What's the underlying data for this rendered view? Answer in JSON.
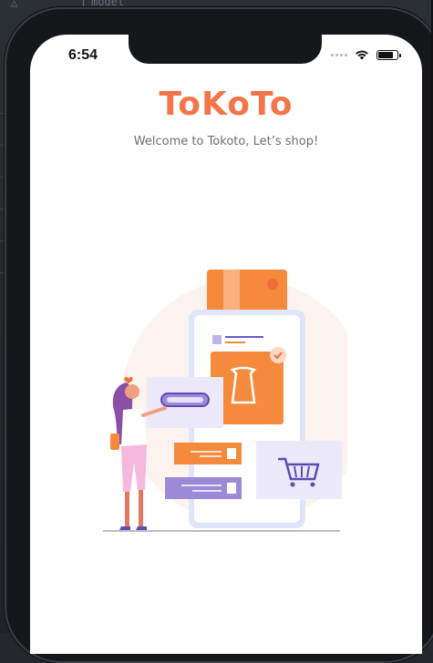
{
  "ide": {
    "tab_fragment": "model"
  },
  "status_bar": {
    "time": "6:54",
    "signal_icon": "cellular-signal-icon",
    "wifi_icon": "wifi-icon",
    "battery_icon": "battery-icon",
    "battery_level": 0.9
  },
  "splash": {
    "title": "ToKoTo",
    "subtitle": "Welcome to Tokoto, Let’s shop!",
    "illustration_icon": "shopping-illustration-icon"
  },
  "colors": {
    "brand": "#f2764a",
    "subtitle": "#6e6e6e",
    "illustration_purple": "#9b8ad8",
    "illustration_orange": "#f58a3c"
  }
}
